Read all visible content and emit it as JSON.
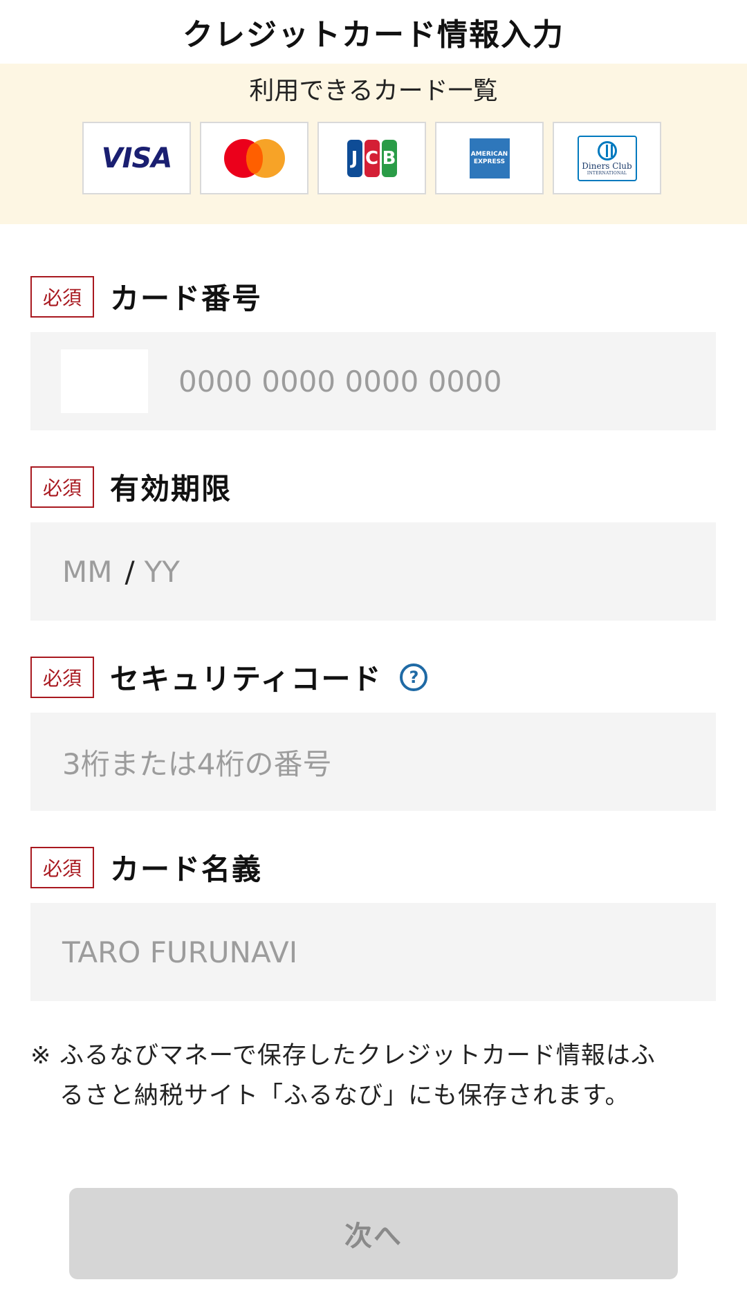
{
  "header": {
    "title": "クレジットカード情報入力"
  },
  "cards": {
    "heading": "利用できるカード一覧",
    "brands": [
      {
        "name": "VISA",
        "icon": "visa-logo"
      },
      {
        "name": "Mastercard",
        "icon": "mastercard-logo"
      },
      {
        "name": "JCB",
        "icon": "jcb-logo"
      },
      {
        "name": "American Express",
        "icon": "amex-logo",
        "text": "AMERICAN EXPRESS"
      },
      {
        "name": "Diners Club",
        "icon": "diners-logo",
        "text": "Diners Club",
        "subtext": "INTERNATIONAL"
      }
    ]
  },
  "form": {
    "required_badge": "必須",
    "card_number": {
      "label": "カード番号",
      "placeholder": "0000 0000 0000 0000"
    },
    "expiry": {
      "label": "有効期限",
      "month_placeholder": "MM",
      "separator": "/",
      "year_placeholder": "YY"
    },
    "security_code": {
      "label": "セキュリティコード",
      "help_icon": "?",
      "placeholder": "3桁または4桁の番号"
    },
    "card_holder": {
      "label": "カード名義",
      "placeholder": "TARO FURUNAVI"
    }
  },
  "note": {
    "mark": "※",
    "line1": "ふるなびマネーで保存したクレジットカード情報はふ",
    "line2": "るさと納税サイト「ふるなび」にも保存されます。"
  },
  "actions": {
    "next_label": "次へ"
  },
  "colors": {
    "cards_panel_bg": "#fdf6e3",
    "required_red": "#a8181f",
    "help_blue": "#1f6aa5",
    "input_bg": "#f4f4f4",
    "button_disabled_bg": "#d6d6d6"
  }
}
